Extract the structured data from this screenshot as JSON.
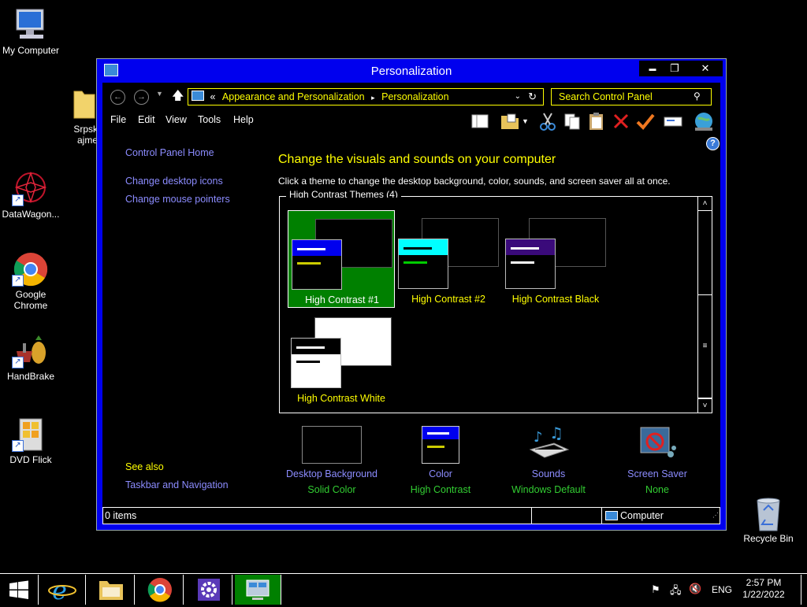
{
  "desktop": {
    "icons": [
      {
        "label": "My Computer"
      },
      {
        "label": "Srpsk\najme"
      },
      {
        "label": "DataWagon..."
      },
      {
        "label": "Google\nChrome"
      },
      {
        "label": "HandBrake"
      },
      {
        "label": "DVD Flick"
      },
      {
        "label": "Recycle Bin"
      }
    ]
  },
  "window": {
    "title": "Personalization",
    "controls": {
      "minimize": "▬",
      "maximize": "❐",
      "close": "✕"
    },
    "address": {
      "prefix": "«",
      "crumb1": "Appearance and Personalization",
      "sep": "▸",
      "crumb2": "Personalization"
    },
    "search": {
      "placeholder": "Search Control Panel"
    },
    "menu": [
      "File",
      "Edit",
      "View",
      "Tools",
      "Help"
    ],
    "sidebar": {
      "home": "Control Panel Home",
      "links": [
        "Change desktop icons",
        "Change mouse pointers"
      ],
      "see_also": "See also",
      "see_also_links": [
        "Taskbar and Navigation"
      ]
    },
    "main": {
      "heading": "Change the visuals and sounds on your computer",
      "subheading": "Click a theme to change the desktop background, color, sounds, and screen saver all at once.",
      "group_title": "High Contrast Themes (4)",
      "themes": [
        {
          "name": "High Contrast #1",
          "selected": true,
          "accent": "#0000ee",
          "line1": "#ffffff",
          "line2": "#cccc00"
        },
        {
          "name": "High Contrast #2",
          "selected": false,
          "accent": "#00ffff",
          "line1": "#000000",
          "line2": "#00cc00"
        },
        {
          "name": "High Contrast Black",
          "selected": false,
          "accent": "#3a0a7a",
          "line1": "#ffffff",
          "line2": "#ffffff"
        },
        {
          "name": "High Contrast White",
          "selected": false,
          "accent": "#000000",
          "line1": "#ffffff",
          "line2": "#000000"
        }
      ]
    },
    "bottom": [
      {
        "label": "Desktop Background",
        "value": "Solid Color"
      },
      {
        "label": "Color",
        "value": "High Contrast"
      },
      {
        "label": "Sounds",
        "value": "Windows Default"
      },
      {
        "label": "Screen Saver",
        "value": "None"
      }
    ],
    "status": {
      "items": "0 items",
      "location": "Computer"
    }
  },
  "taskbar": {
    "lang": "ENG",
    "time": "2:57 PM",
    "date": "1/22/2022"
  },
  "colors": {
    "window_frame": "#0000ee",
    "link": "#8c8cff",
    "highlight_text": "#ffff00",
    "selected_bg": "#008000",
    "value_text": "#32cd32"
  }
}
